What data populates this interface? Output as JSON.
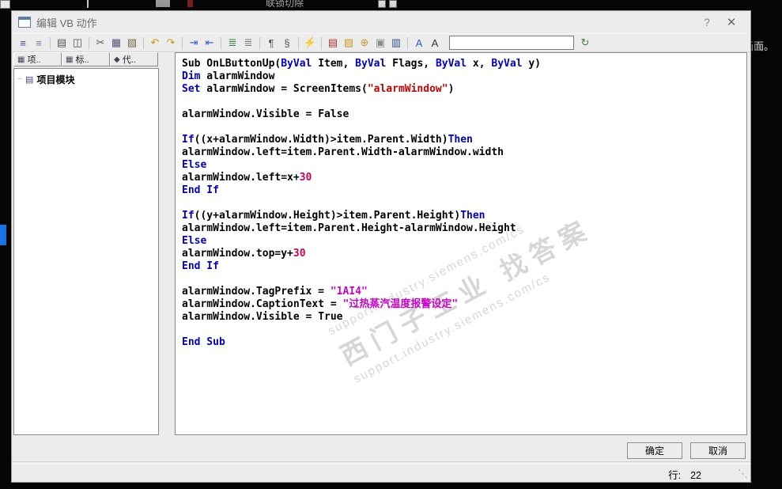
{
  "background": {
    "top_label": "联锁切除",
    "right_label": "画面。"
  },
  "dialog": {
    "title": "编辑 VB 动作",
    "help_label": "?",
    "close_label": "✕",
    "toolbar": {
      "search_value": "",
      "icons": [
        {
          "name": "format-list-icon",
          "glyph": "≡",
          "color": "#35508c"
        },
        {
          "name": "format-list-colored-icon",
          "glyph": "≡",
          "color": "#6d7fb0"
        },
        {
          "name": "print-icon",
          "glyph": "▤",
          "color": "#555555",
          "sep": true
        },
        {
          "name": "print-preview-icon",
          "glyph": "◫",
          "color": "#555555"
        },
        {
          "name": "cut-icon",
          "glyph": "✂",
          "color": "#555555",
          "sep": true
        },
        {
          "name": "copy-icon",
          "glyph": "▦",
          "color": "#555577"
        },
        {
          "name": "paste-icon",
          "glyph": "▧",
          "color": "#766a4a"
        },
        {
          "name": "undo-icon",
          "glyph": "↶",
          "color": "#d79400",
          "sep": true
        },
        {
          "name": "redo-icon",
          "glyph": "↷",
          "color": "#d79400"
        },
        {
          "name": "indent-increase-icon",
          "glyph": "⇥",
          "color": "#2d5fc8",
          "sep": true
        },
        {
          "name": "indent-decrease-icon",
          "glyph": "⇤",
          "color": "#2d5fc8"
        },
        {
          "name": "comment-block-icon",
          "glyph": "≣",
          "color": "#3a7d3a",
          "sep": true
        },
        {
          "name": "uncomment-block-icon",
          "glyph": "≣",
          "color": "#777777"
        },
        {
          "name": "paragraph-marks-icon",
          "glyph": "¶",
          "color": "#555555",
          "sep": true
        },
        {
          "name": "special-chars-icon",
          "glyph": "§",
          "color": "#555555"
        },
        {
          "name": "syntax-check-icon",
          "glyph": "⚡",
          "color": "#2d5fc8",
          "sep": true
        },
        {
          "name": "script-book-icon",
          "glyph": "▤",
          "color": "#b03030",
          "sep": true
        },
        {
          "name": "folder-icon",
          "glyph": "▨",
          "color": "#c89a28"
        },
        {
          "name": "add-object-icon",
          "glyph": "⊕",
          "color": "#c89a28"
        },
        {
          "name": "snapshot-icon",
          "glyph": "▣",
          "color": "#8a8a8a"
        },
        {
          "name": "library-book-icon",
          "glyph": "▥",
          "color": "#35508c"
        },
        {
          "name": "text-wave-blue-icon",
          "glyph": "A",
          "color": "#2d5fc8",
          "sep": true
        },
        {
          "name": "text-wave-icon",
          "glyph": "A",
          "color": "#333333"
        }
      ],
      "trailing_icon": {
        "name": "refresh-clock-icon",
        "glyph": "↻",
        "color": "#3a7d3a"
      }
    },
    "left_panel": {
      "tabs": [
        {
          "label": "项..",
          "icon": "▦"
        },
        {
          "label": "标..",
          "icon": "▦"
        },
        {
          "label": "代..",
          "icon": "◆"
        }
      ],
      "tree": {
        "dots": "┈",
        "icon": "▤",
        "root_label": "项目模块"
      }
    },
    "editor": {
      "watermark": {
        "url_top": "support.industry.siemens.com/cs",
        "cn": "西门子工业 找答案",
        "url_bottom": "support.industry.siemens.com/cs"
      },
      "lines": [
        [
          [
            "p",
            "Sub OnLButtonUp("
          ],
          [
            "k",
            "ByVal"
          ],
          [
            "p",
            " Item, "
          ],
          [
            "k",
            "ByVal"
          ],
          [
            "p",
            " Flags, "
          ],
          [
            "k",
            "ByVal"
          ],
          [
            "p",
            " x, "
          ],
          [
            "k",
            "ByVal"
          ],
          [
            "p",
            " y)"
          ]
        ],
        [
          [
            "k",
            "Dim"
          ],
          [
            "p",
            " alarmWindow"
          ]
        ],
        [
          [
            "k",
            "Set"
          ],
          [
            "p",
            " alarmWindow = ScreenItems("
          ],
          [
            "s",
            "\"alarmWindow\""
          ],
          [
            "p",
            ")"
          ]
        ],
        [],
        [
          [
            "p",
            "alarmWindow.Visible = "
          ],
          [
            "b",
            "False"
          ]
        ],
        [],
        [
          [
            "k",
            "If"
          ],
          [
            "p",
            "((x+alarmWindow.Width)>item.Parent.Width)"
          ],
          [
            "k",
            "Then"
          ]
        ],
        [
          [
            "p",
            "alarmWindow.left=item.Parent.Width-alarmWindow.width"
          ]
        ],
        [
          [
            "k",
            "Else"
          ]
        ],
        [
          [
            "p",
            "alarmWindow.left=x+"
          ],
          [
            "n",
            "30"
          ]
        ],
        [
          [
            "k",
            "End If"
          ]
        ],
        [],
        [
          [
            "k",
            "If"
          ],
          [
            "p",
            "((y+alarmWindow.Height)>item.Parent.Height)"
          ],
          [
            "k",
            "Then"
          ]
        ],
        [
          [
            "p",
            "alarmWindow.left=item.Parent.Height-alarmWindow.Height"
          ]
        ],
        [
          [
            "k",
            "Else"
          ]
        ],
        [
          [
            "p",
            "alarmWindow.top=y+"
          ],
          [
            "n",
            "30"
          ]
        ],
        [
          [
            "k",
            "End If"
          ]
        ],
        [],
        [
          [
            "p",
            "alarmWindow.TagPrefix = "
          ],
          [
            "m",
            "\"1AI4\""
          ]
        ],
        [
          [
            "p",
            "alarmWindow.CaptionText = "
          ],
          [
            "m",
            "\"过热蒸汽温度报警设定\""
          ]
        ],
        [
          [
            "p",
            "alarmWindow.Visible = "
          ],
          [
            "b",
            "True"
          ]
        ],
        [],
        [
          [
            "k",
            "End Sub"
          ]
        ]
      ]
    },
    "ok_label": "确定",
    "cancel_label": "取消",
    "status": {
      "line_label": "行:",
      "line_value": "22",
      "grip": "⋱"
    }
  }
}
